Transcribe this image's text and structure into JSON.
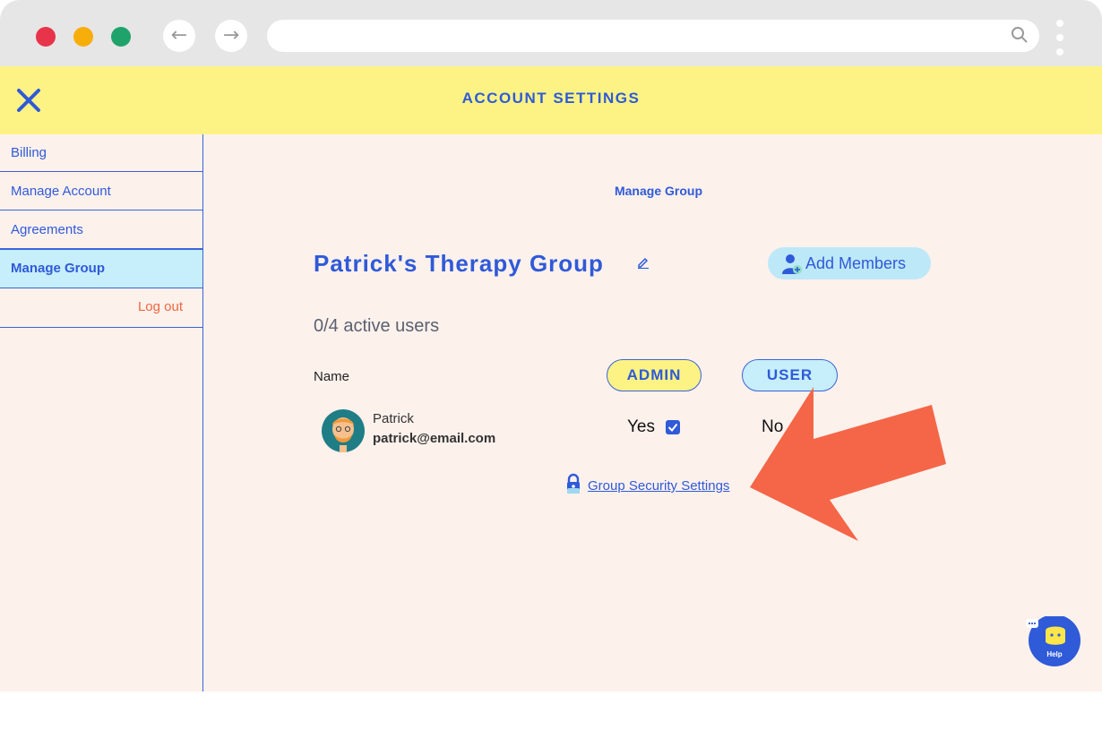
{
  "header": {
    "title": "ACCOUNT SETTINGS"
  },
  "sidebar": {
    "items": [
      {
        "label": "Billing"
      },
      {
        "label": "Manage Account"
      },
      {
        "label": "Agreements"
      },
      {
        "label": "Manage Group"
      }
    ],
    "logout_label": "Log out",
    "active_item": "Manage Group"
  },
  "main": {
    "subtitle": "Manage Group",
    "group_name": "Patrick's Therapy Group",
    "add_members_label": "Add Members",
    "active_users": "0/4 active users",
    "table": {
      "name_header": "Name",
      "admin_header": "ADMIN",
      "user_header": "USER",
      "rows": [
        {
          "name": "Patrick",
          "email": "patrick@email.com",
          "admin": "Yes",
          "admin_checked": true,
          "user": "No"
        }
      ]
    },
    "security_link": "Group Security Settings"
  },
  "help": {
    "label": "Help"
  },
  "colors": {
    "brand_blue": "#2f5ad8",
    "header_yellow": "#fdf384",
    "background_peach": "#fdf1ec",
    "highlight_cyan": "#c6eefb",
    "logout_orange": "#f26640",
    "arrow_orange": "#f46647"
  },
  "icons": [
    "close-icon",
    "edit-icon",
    "add-member-icon",
    "lock-icon",
    "help-chat-icon",
    "search-icon",
    "back-arrow-icon",
    "forward-arrow-icon"
  ]
}
